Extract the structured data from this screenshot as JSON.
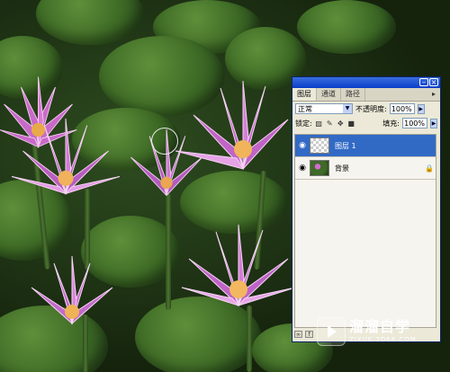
{
  "palette": {
    "tabs": [
      {
        "label": "图层",
        "active": true
      },
      {
        "label": "通道",
        "active": false
      },
      {
        "label": "路径",
        "active": false
      }
    ],
    "blend_mode": "正常",
    "opacity_label": "不透明度:",
    "opacity_value": "100%",
    "lock_label": "锁定:",
    "fill_label": "填充:",
    "fill_value": "100%",
    "layers": [
      {
        "name": "图层 1",
        "selected": true,
        "visible": true,
        "locked": false
      },
      {
        "name": "背景",
        "selected": false,
        "visible": true,
        "locked": true
      }
    ],
    "colors": {
      "selected": "#316ac5",
      "titlebar": "#0a3ec8",
      "panel": "#ece9d8"
    }
  },
  "watermark": {
    "title": "溜溜自学",
    "url": "ZIXUE.3D66.COM"
  },
  "icons": [
    "minimize-icon",
    "close-icon",
    "eye-icon",
    "lock-icon",
    "brush-cursor-icon",
    "play-logo-icon"
  ]
}
